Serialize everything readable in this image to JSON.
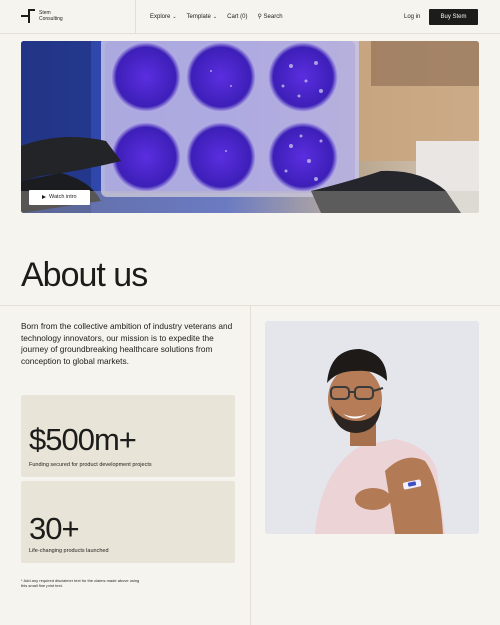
{
  "nav": {
    "logo_line1": "Stem",
    "logo_line2": "Consulting",
    "explore": "Explore",
    "template": "Template",
    "cart": "Cart (0)",
    "search": "Search",
    "login": "Log in",
    "buy": "Buy Stem"
  },
  "hero": {
    "watch_label": "Watch intro"
  },
  "about": {
    "title": "About us",
    "intro": "Born from the collective ambition of industry veterans and technology innovators, our mission is to expedite the journey of groundbreaking healthcare solutions from conception to global markets.",
    "stats": [
      {
        "value": "$500m+",
        "label": "Funding secured for product development projects"
      },
      {
        "value": "30+",
        "label": "Life-changing products launched"
      }
    ],
    "footnote": "* Add any required disclaimer text for the claims made above using this small fine print text."
  },
  "colors": {
    "background": "#f6f4ee",
    "ink": "#1c1c1a",
    "stat_card": "#e9e4d8"
  }
}
